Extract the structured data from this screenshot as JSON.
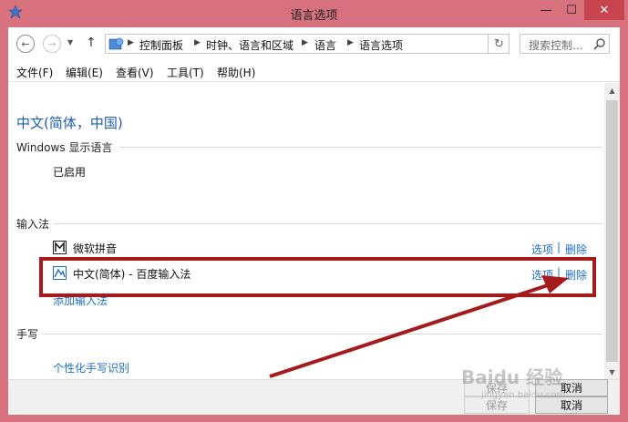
{
  "window": {
    "title": "语言选项",
    "minimize": "—",
    "maximize": "☐",
    "close": "✕"
  },
  "address": {
    "crumbs": [
      "控制面板",
      "时钟、语言和区域",
      "语言",
      "语言选项"
    ],
    "search_placeholder": "搜索控制..."
  },
  "menu": {
    "items": [
      "文件(F)",
      "编辑(E)",
      "查看(V)",
      "工具(T)",
      "帮助(H)"
    ]
  },
  "content": {
    "language_title": "中文(简体，中国)",
    "display_language": {
      "heading": "Windows 显示语言",
      "status": "已启用"
    },
    "input_methods": {
      "heading": "输入法",
      "items": [
        {
          "name": "微软拼音",
          "options": "选项",
          "separator": "|",
          "remove": "删除"
        },
        {
          "name": "中文(简体) - 百度输入法",
          "options": "选项",
          "separator": "|",
          "remove": "删除"
        }
      ],
      "add_link": "添加输入法"
    },
    "handwriting": {
      "heading": "手写",
      "link": "个性化手写识别"
    }
  },
  "footer": {
    "save_top": "保存",
    "cancel_top": "取消",
    "save": "保存",
    "cancel": "取消"
  },
  "watermark": {
    "main": "Baidu 经验",
    "sub": "jingyan.baidu.com"
  },
  "colors": {
    "frame": "#d6717d",
    "link": "#1e6ec8",
    "title": "#1e5cb3",
    "annotation": "#a51a1a"
  }
}
